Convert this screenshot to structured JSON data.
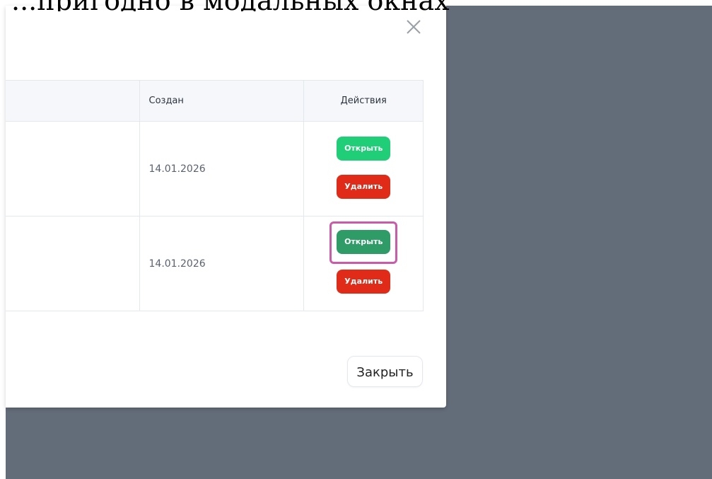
{
  "top_caption": "...пригодно в модальных окнах на сайте...",
  "modal": {
    "close_icon": "close-icon",
    "close_button_label": "Закрыть",
    "table": {
      "headers": [
        "",
        "Создан",
        "Действия"
      ],
      "rows": [
        {
          "created": "14.01.2026",
          "actions": {
            "open_label": "Открыть",
            "delete_label": "Удалить"
          }
        },
        {
          "created": "14.01.2026",
          "actions": {
            "open_label": "Открыть",
            "delete_label": "Удалить"
          }
        }
      ]
    }
  },
  "colors": {
    "backdrop": "#636c79",
    "open": "#1fce76",
    "open_selected": "#2f9b67",
    "delete": "#df2b18",
    "highlight": "#c95ba8"
  }
}
